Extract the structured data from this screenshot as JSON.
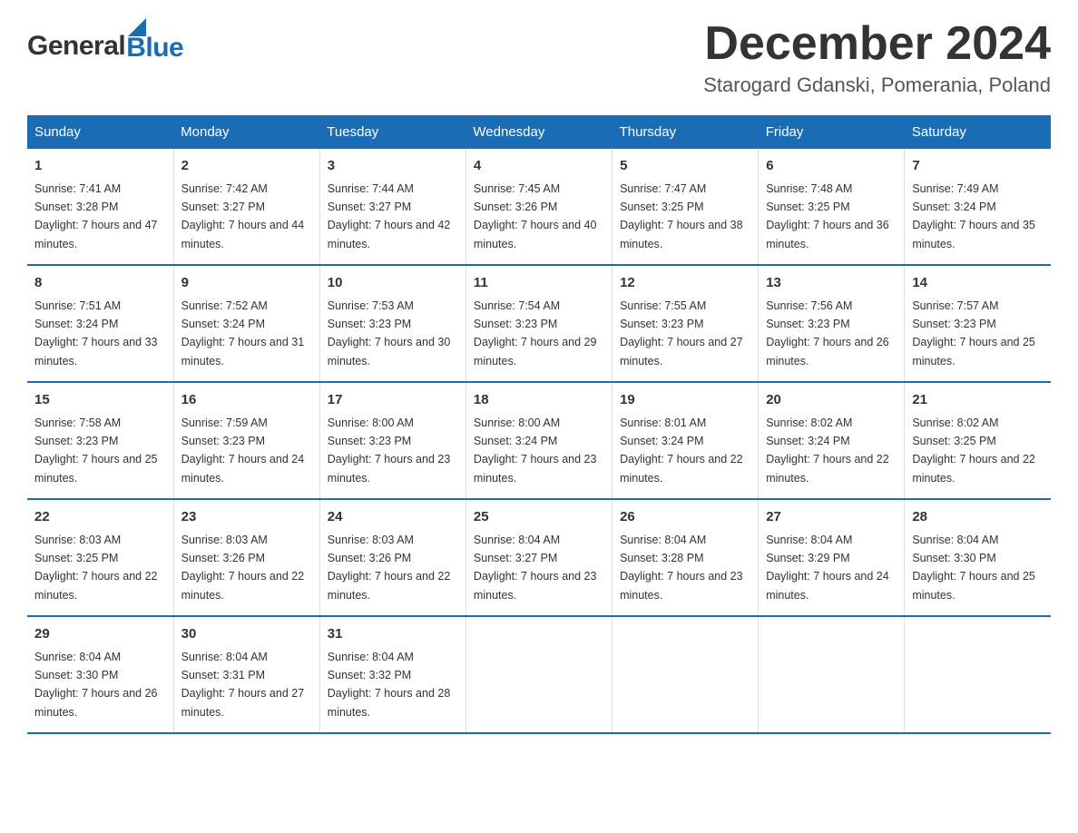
{
  "header": {
    "logo_general": "General",
    "logo_blue": "Blue",
    "month_title": "December 2024",
    "location": "Starogard Gdanski, Pomerania, Poland"
  },
  "calendar": {
    "days_of_week": [
      "Sunday",
      "Monday",
      "Tuesday",
      "Wednesday",
      "Thursday",
      "Friday",
      "Saturday"
    ],
    "weeks": [
      [
        {
          "day": "1",
          "sunrise": "Sunrise: 7:41 AM",
          "sunset": "Sunset: 3:28 PM",
          "daylight": "Daylight: 7 hours and 47 minutes."
        },
        {
          "day": "2",
          "sunrise": "Sunrise: 7:42 AM",
          "sunset": "Sunset: 3:27 PM",
          "daylight": "Daylight: 7 hours and 44 minutes."
        },
        {
          "day": "3",
          "sunrise": "Sunrise: 7:44 AM",
          "sunset": "Sunset: 3:27 PM",
          "daylight": "Daylight: 7 hours and 42 minutes."
        },
        {
          "day": "4",
          "sunrise": "Sunrise: 7:45 AM",
          "sunset": "Sunset: 3:26 PM",
          "daylight": "Daylight: 7 hours and 40 minutes."
        },
        {
          "day": "5",
          "sunrise": "Sunrise: 7:47 AM",
          "sunset": "Sunset: 3:25 PM",
          "daylight": "Daylight: 7 hours and 38 minutes."
        },
        {
          "day": "6",
          "sunrise": "Sunrise: 7:48 AM",
          "sunset": "Sunset: 3:25 PM",
          "daylight": "Daylight: 7 hours and 36 minutes."
        },
        {
          "day": "7",
          "sunrise": "Sunrise: 7:49 AM",
          "sunset": "Sunset: 3:24 PM",
          "daylight": "Daylight: 7 hours and 35 minutes."
        }
      ],
      [
        {
          "day": "8",
          "sunrise": "Sunrise: 7:51 AM",
          "sunset": "Sunset: 3:24 PM",
          "daylight": "Daylight: 7 hours and 33 minutes."
        },
        {
          "day": "9",
          "sunrise": "Sunrise: 7:52 AM",
          "sunset": "Sunset: 3:24 PM",
          "daylight": "Daylight: 7 hours and 31 minutes."
        },
        {
          "day": "10",
          "sunrise": "Sunrise: 7:53 AM",
          "sunset": "Sunset: 3:23 PM",
          "daylight": "Daylight: 7 hours and 30 minutes."
        },
        {
          "day": "11",
          "sunrise": "Sunrise: 7:54 AM",
          "sunset": "Sunset: 3:23 PM",
          "daylight": "Daylight: 7 hours and 29 minutes."
        },
        {
          "day": "12",
          "sunrise": "Sunrise: 7:55 AM",
          "sunset": "Sunset: 3:23 PM",
          "daylight": "Daylight: 7 hours and 27 minutes."
        },
        {
          "day": "13",
          "sunrise": "Sunrise: 7:56 AM",
          "sunset": "Sunset: 3:23 PM",
          "daylight": "Daylight: 7 hours and 26 minutes."
        },
        {
          "day": "14",
          "sunrise": "Sunrise: 7:57 AM",
          "sunset": "Sunset: 3:23 PM",
          "daylight": "Daylight: 7 hours and 25 minutes."
        }
      ],
      [
        {
          "day": "15",
          "sunrise": "Sunrise: 7:58 AM",
          "sunset": "Sunset: 3:23 PM",
          "daylight": "Daylight: 7 hours and 25 minutes."
        },
        {
          "day": "16",
          "sunrise": "Sunrise: 7:59 AM",
          "sunset": "Sunset: 3:23 PM",
          "daylight": "Daylight: 7 hours and 24 minutes."
        },
        {
          "day": "17",
          "sunrise": "Sunrise: 8:00 AM",
          "sunset": "Sunset: 3:23 PM",
          "daylight": "Daylight: 7 hours and 23 minutes."
        },
        {
          "day": "18",
          "sunrise": "Sunrise: 8:00 AM",
          "sunset": "Sunset: 3:24 PM",
          "daylight": "Daylight: 7 hours and 23 minutes."
        },
        {
          "day": "19",
          "sunrise": "Sunrise: 8:01 AM",
          "sunset": "Sunset: 3:24 PM",
          "daylight": "Daylight: 7 hours and 22 minutes."
        },
        {
          "day": "20",
          "sunrise": "Sunrise: 8:02 AM",
          "sunset": "Sunset: 3:24 PM",
          "daylight": "Daylight: 7 hours and 22 minutes."
        },
        {
          "day": "21",
          "sunrise": "Sunrise: 8:02 AM",
          "sunset": "Sunset: 3:25 PM",
          "daylight": "Daylight: 7 hours and 22 minutes."
        }
      ],
      [
        {
          "day": "22",
          "sunrise": "Sunrise: 8:03 AM",
          "sunset": "Sunset: 3:25 PM",
          "daylight": "Daylight: 7 hours and 22 minutes."
        },
        {
          "day": "23",
          "sunrise": "Sunrise: 8:03 AM",
          "sunset": "Sunset: 3:26 PM",
          "daylight": "Daylight: 7 hours and 22 minutes."
        },
        {
          "day": "24",
          "sunrise": "Sunrise: 8:03 AM",
          "sunset": "Sunset: 3:26 PM",
          "daylight": "Daylight: 7 hours and 22 minutes."
        },
        {
          "day": "25",
          "sunrise": "Sunrise: 8:04 AM",
          "sunset": "Sunset: 3:27 PM",
          "daylight": "Daylight: 7 hours and 23 minutes."
        },
        {
          "day": "26",
          "sunrise": "Sunrise: 8:04 AM",
          "sunset": "Sunset: 3:28 PM",
          "daylight": "Daylight: 7 hours and 23 minutes."
        },
        {
          "day": "27",
          "sunrise": "Sunrise: 8:04 AM",
          "sunset": "Sunset: 3:29 PM",
          "daylight": "Daylight: 7 hours and 24 minutes."
        },
        {
          "day": "28",
          "sunrise": "Sunrise: 8:04 AM",
          "sunset": "Sunset: 3:30 PM",
          "daylight": "Daylight: 7 hours and 25 minutes."
        }
      ],
      [
        {
          "day": "29",
          "sunrise": "Sunrise: 8:04 AM",
          "sunset": "Sunset: 3:30 PM",
          "daylight": "Daylight: 7 hours and 26 minutes."
        },
        {
          "day": "30",
          "sunrise": "Sunrise: 8:04 AM",
          "sunset": "Sunset: 3:31 PM",
          "daylight": "Daylight: 7 hours and 27 minutes."
        },
        {
          "day": "31",
          "sunrise": "Sunrise: 8:04 AM",
          "sunset": "Sunset: 3:32 PM",
          "daylight": "Daylight: 7 hours and 28 minutes."
        },
        null,
        null,
        null,
        null
      ]
    ]
  }
}
